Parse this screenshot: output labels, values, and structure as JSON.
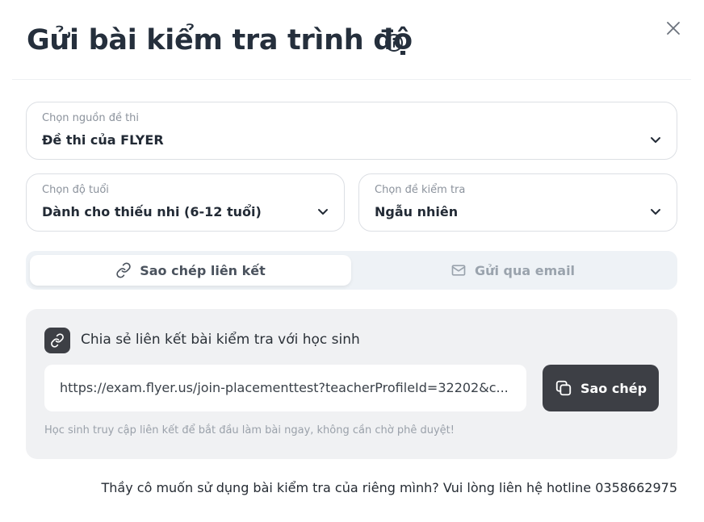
{
  "header": {
    "title": "Gửi bài kiểm tra trình độ"
  },
  "source_select": {
    "label": "Chọn nguồn đề thi",
    "value": "Đề thi của FLYER"
  },
  "age_select": {
    "label": "Chọn độ tuổi",
    "value": "Dành cho thiếu nhi (6-12 tuổi)"
  },
  "test_select": {
    "label": "Chọn đề kiểm tra",
    "value": "Ngẫu nhiên"
  },
  "tabs": [
    {
      "label": "Sao chép liên kết",
      "icon": "link-icon",
      "active": true
    },
    {
      "label": "Gửi qua email",
      "icon": "mail-icon",
      "active": false
    }
  ],
  "share": {
    "title": "Chia sẻ liên kết bài kiểm tra với học sinh",
    "link": "https://exam.flyer.us/join-placementtest?teacherProfileId=32202&c...",
    "copy_label": "Sao chép",
    "hint": "Học sinh truy cập liên kết để bắt đầu làm bài ngay, không cần chờ phê duyệt!"
  },
  "footer": {
    "text": "Thầy cô muốn sử dụng bài kiểm tra của riêng mình? Vui lòng liên hệ hotline 0358662975"
  },
  "colors": {
    "dark_button": "#3d3f45",
    "tab_bg": "#eef2f6",
    "panel_bg": "#f0f1f3"
  }
}
